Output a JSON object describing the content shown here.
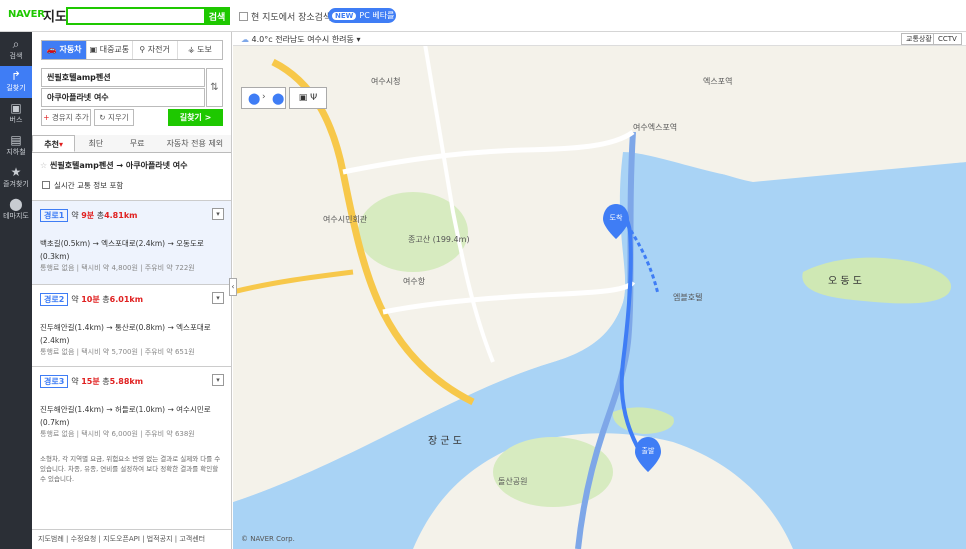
{
  "topbar": {
    "logo": "NAVER",
    "logo_sub": "지도",
    "search_placeholder": "",
    "search_button": "검색",
    "area_search_label": "현 지도에서 장소검색",
    "beta_badge": "NEW",
    "beta_label": "PC 베타를 체험해 보기 >"
  },
  "leftnav": [
    {
      "label": "검색",
      "icon": "search-icon"
    },
    {
      "label": "길찾기",
      "icon": "directions-icon"
    },
    {
      "label": "버스",
      "icon": "bus-icon"
    },
    {
      "label": "지하철",
      "icon": "subway-icon"
    },
    {
      "label": "즐겨찾기",
      "icon": "star-icon"
    },
    {
      "label": "테마지도",
      "icon": "pin-icon"
    }
  ],
  "modes": [
    "자동차",
    "대중교통",
    "자전거",
    "도보"
  ],
  "start_point": "씬필호텔amp펜션",
  "end_point": "아쿠아플라넷 여수",
  "add_waypoint": "경유지 추가",
  "clear": "지우기",
  "go_button": "길찾기 >",
  "tabs": [
    "추천",
    "최단",
    "무료",
    "자동차 전용 제외"
  ],
  "summary": "씬필호텔amp펜션 → 아쿠아플라넷 여수",
  "realtime_label": "실시간 교통 정보 포함",
  "routes": [
    {
      "num": "경로1",
      "time_prefix": "약",
      "time": "9분",
      "dist_prefix": "총",
      "dist": "4.81km",
      "path": "백초길(0.5km) → 엑스포대로(2.4km) → 오동도로(0.3km)",
      "meta": "통행료 없음 | 택시비 약 4,800원 | 주유비 약 722원"
    },
    {
      "num": "경로2",
      "time_prefix": "약",
      "time": "10분",
      "dist_prefix": "총",
      "dist": "6.01km",
      "path": "진두해안길(1.4km) → 통산로(0.8km) → 엑스포대로(2.4km)",
      "meta": "통행료 없음 | 택시비 약 5,700원 | 주유비 약 651원"
    },
    {
      "num": "경로3",
      "time_prefix": "약",
      "time": "15분",
      "dist_prefix": "총",
      "dist": "5.88km",
      "path": "진두해안길(1.4km) → 허들로(1.0km) → 여수시민로(0.7km)",
      "meta": "통행료 없음 | 택시비 약 6,000원 | 주유비 약 638원"
    }
  ],
  "notice": "소형차, 각 지역별 요금, 위험요소 반영 없는 결과로 실제와 다를 수 있습니다. 차종, 유종, 연비를 설정하여 보다 정확한 결과를 확인할 수 있습니다.",
  "footer": "지도범례 | 수정요청 | 지도오픈API | 법적공지 | 고객센터",
  "map": {
    "weather": "4.0°c 전라남도 여수시 한려동",
    "traffic_btn": "교통상황",
    "cctv_btn": "CCTV",
    "copyright": "© NAVER Corp.",
    "labels": {
      "island1": "오 동 도",
      "island2": "장 군 도",
      "mountain": "종고산 (199.4m)",
      "start_marker": "출발",
      "end_marker": "도착",
      "place1": "여수시청",
      "place2": "여수엑스포역",
      "place3": "엑스포역",
      "place4": "여수시민회관",
      "place5": "여수항",
      "place6": "엠블호텔",
      "place7": "돌산공원"
    }
  }
}
